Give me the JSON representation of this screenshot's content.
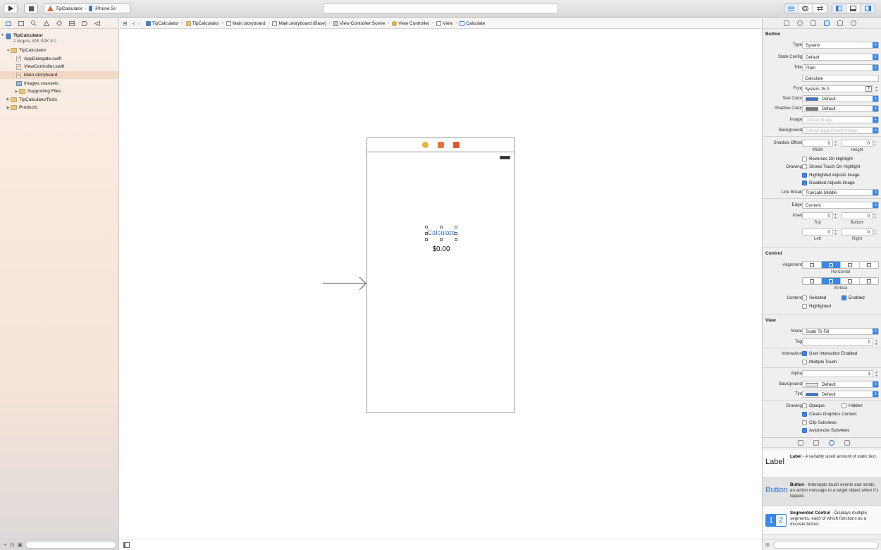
{
  "toolbar": {
    "scheme": "TipCalculator",
    "device": "iPhone 5s",
    "activity_text": ""
  },
  "navigator": {
    "project": {
      "name": "TipCalculator",
      "subtitle": "2 targets, iOS SDK 8.0"
    },
    "items": [
      {
        "label": "TipCalculator"
      },
      {
        "label": "AppDelegate.swift"
      },
      {
        "label": "ViewController.swift"
      },
      {
        "label": "Main.storyboard"
      },
      {
        "label": "Images.xcassets"
      },
      {
        "label": "Supporting Files"
      },
      {
        "label": "TipCalculatorTests"
      },
      {
        "label": "Products"
      }
    ]
  },
  "jumpbar": {
    "crumbs": [
      "TipCalculator",
      "TipCalculator",
      "Main.storyboard",
      "Main.storyboard (Base)",
      "View Controller Scene",
      "View Controller",
      "View",
      "Calculate"
    ]
  },
  "canvas": {
    "button_title": "Calculate",
    "label_text": "$0.00"
  },
  "inspector": {
    "button": {
      "section": "Button",
      "type_label": "Type",
      "type_value": "System",
      "state_label": "State Config",
      "state_value": "Default",
      "title_label": "Title",
      "title_value": "Plain",
      "title_text": "Calculate",
      "font_label": "Font",
      "font_value": "System 15.0",
      "text_color_label": "Text Color",
      "text_color_value": "Default",
      "shadow_color_label": "Shadow Color",
      "shadow_color_value": "Default",
      "image_label": "Image",
      "image_placeholder": "Default Image",
      "background_label": "Background",
      "background_placeholder": "Default Background Image",
      "shadow_offset_label": "Shadow Offset",
      "shadow_w": "0",
      "shadow_h": "0",
      "width_label": "Width",
      "height_label": "Height",
      "reverses": "Reverses On Highlight",
      "drawing_label": "Drawing",
      "shows_touch": "Shows Touch On Highlight",
      "highlighted_adjusts": "Highlighted Adjusts Image",
      "disabled_adjusts": "Disabled Adjusts Image",
      "line_break_label": "Line Break",
      "line_break_value": "Truncate Middle",
      "edge_label": "Edge",
      "edge_value": "Content",
      "inset_label": "Inset",
      "inset_top": "0",
      "inset_bottom": "0",
      "inset_left": "0",
      "inset_right": "0",
      "top_label": "Top",
      "bottom_label": "Bottom",
      "left_label": "Left",
      "right_label": "Right"
    },
    "control": {
      "section": "Control",
      "alignment_label": "Alignment",
      "horizontal_label": "Horizontal",
      "vertical_label": "Vertical",
      "content_label": "Content",
      "selected": "Selected",
      "enabled": "Enabled",
      "highlighted": "Highlighted"
    },
    "view": {
      "section": "View",
      "mode_label": "Mode",
      "mode_value": "Scale To Fill",
      "tag_label": "Tag",
      "tag_value": "0",
      "interaction_label": "Interaction",
      "user_interaction": "User Interaction Enabled",
      "multiple_touch": "Multiple Touch",
      "alpha_label": "Alpha",
      "alpha_value": "1",
      "background_label": "Background",
      "background_value": "Default",
      "tint_label": "Tint",
      "tint_value": "Default",
      "drawing_label": "Drawing",
      "opaque": "Opaque",
      "hidden": "Hidden",
      "clears": "Clears Graphics Context",
      "clip": "Clip Subviews",
      "autoresize": "Autoresize Subviews"
    }
  },
  "library": {
    "items": [
      {
        "icon": "Label",
        "title": "Label",
        "desc": " - A variably sized amount of static text."
      },
      {
        "icon": "Button",
        "title": "Button",
        "desc": " - Intercepts touch events and sends an action message to a target object when it's tapped."
      },
      {
        "icon_1": "1",
        "icon_2": "2",
        "title": "Segmented Control",
        "desc": " - Displays multiple segments, each of which functions as a discrete button."
      }
    ]
  },
  "colors": {
    "accent": "#3a86e8",
    "button_text": "#2f7bd6",
    "selection": "#f1d8c5"
  }
}
